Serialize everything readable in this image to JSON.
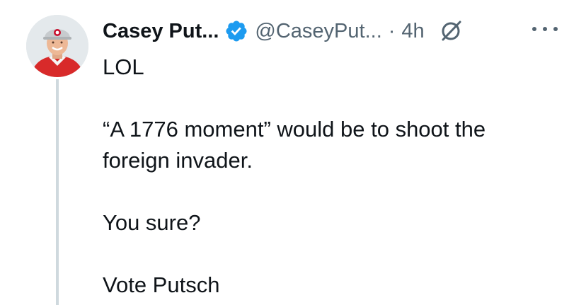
{
  "tweet": {
    "author": {
      "display_name": "Casey Put...",
      "handle": "@CaseyPut...",
      "verified": true,
      "verified_color": "#1d9bf0"
    },
    "separator": "·",
    "timestamp": "4h",
    "icons": {
      "avatar": "profile-photo",
      "verified": "verified-badge-icon",
      "grok": "grok-slash-icon",
      "more": "more-options-icon"
    },
    "text_lines": [
      "LOL",
      "",
      "“A 1776 moment” would be to shoot the",
      "foreign invader.",
      "",
      "You sure?",
      "",
      "Vote Putsch"
    ]
  },
  "colors": {
    "text_primary": "#0f1419",
    "text_secondary": "#536471",
    "thread_line": "#cfd9de",
    "background": "#ffffff"
  }
}
